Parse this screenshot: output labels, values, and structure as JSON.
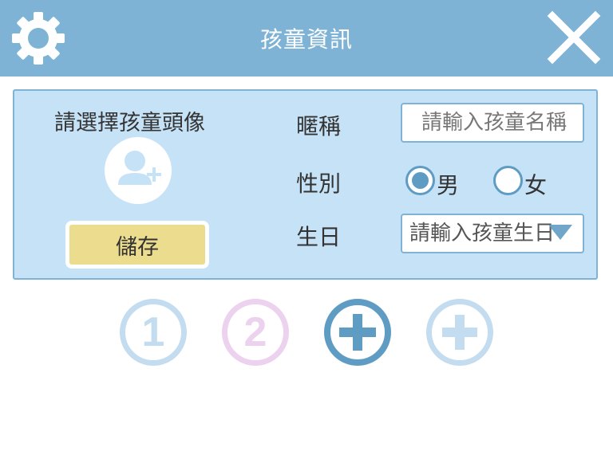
{
  "header": {
    "title": "孩童資訊"
  },
  "profile": {
    "avatar_label": "請選擇孩童頭像",
    "save_label": "儲存"
  },
  "form": {
    "nickname_label": "暱稱",
    "nickname_placeholder": "請輸入孩童名稱",
    "gender_label": "性別",
    "gender_options": [
      "男",
      "女"
    ],
    "gender_selected": "男",
    "birthday_label": "生日",
    "birthday_placeholder": "請輸入孩童生日"
  },
  "child_slots": [
    {
      "label": "1",
      "color": "#c3dcef",
      "type": "child"
    },
    {
      "label": "2",
      "color": "#ecd2ee",
      "type": "child"
    },
    {
      "label": "+",
      "color": "#5f9cc4",
      "type": "add",
      "active": true
    },
    {
      "label": "+",
      "color": "#c3dcef",
      "type": "add",
      "active": false
    }
  ],
  "icons": {
    "settings": "gear-icon",
    "close": "close-icon",
    "avatar": "add-user-icon",
    "dropdown": "triangle-down-icon"
  },
  "colors": {
    "header_bg": "#7fb3d5",
    "panel_bg": "#c6e2f6",
    "save_button": "#ebdc8e",
    "accent": "#5f9cc4"
  }
}
